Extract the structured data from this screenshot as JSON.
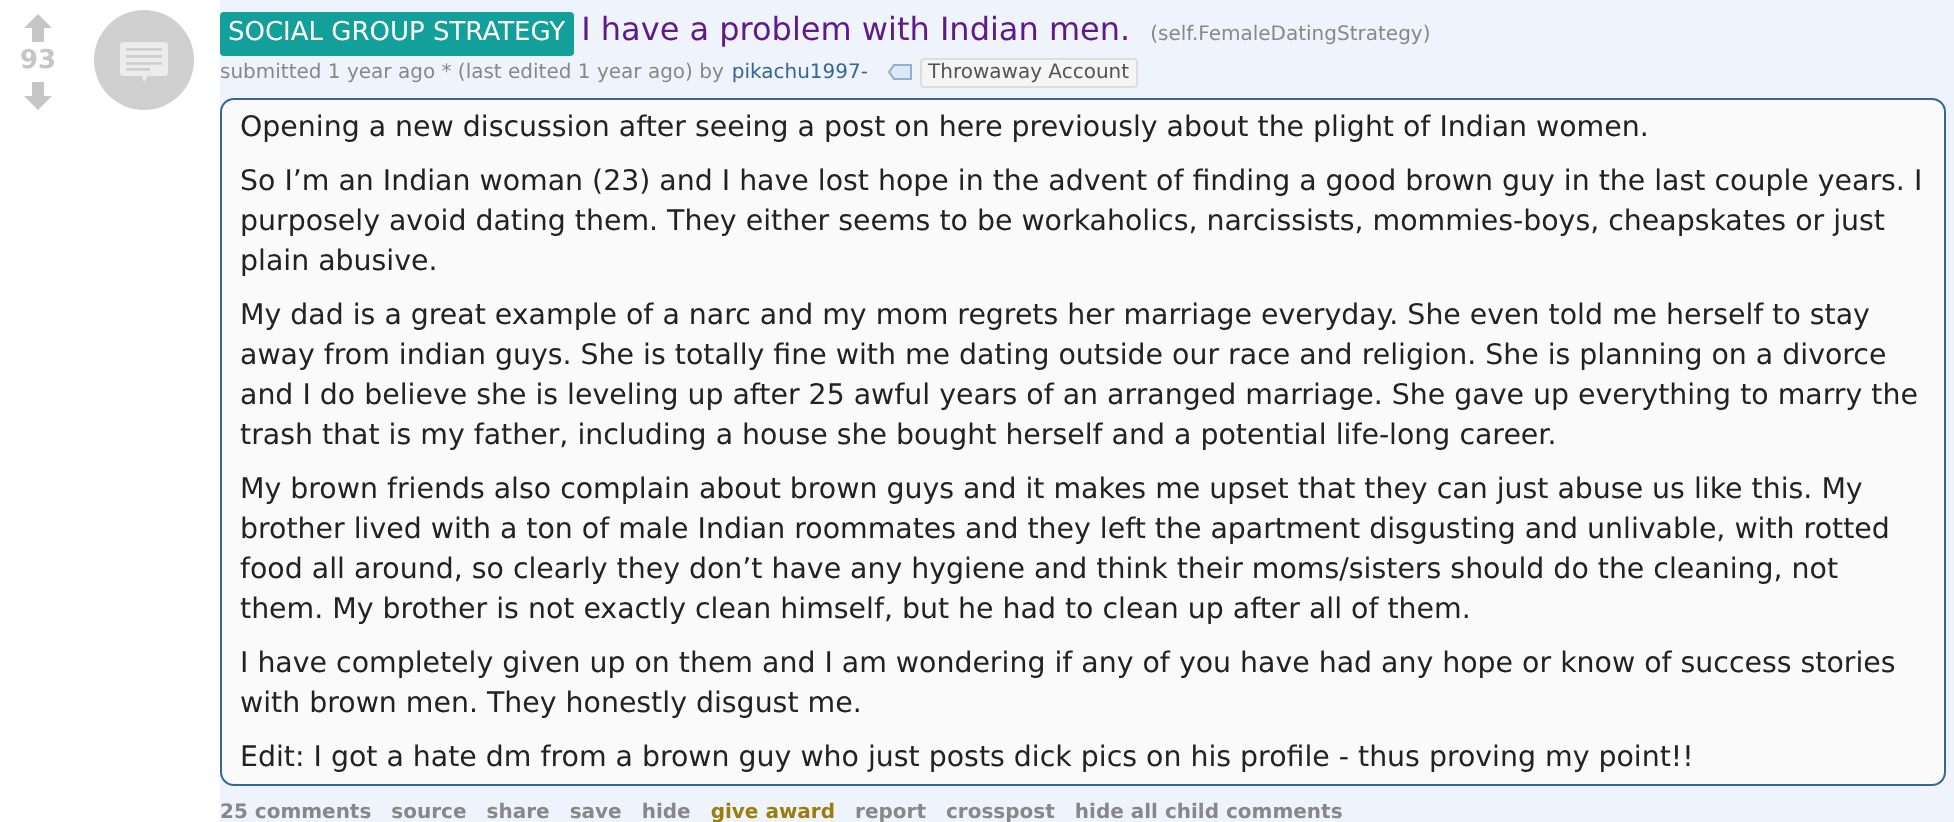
{
  "vote": {
    "score": "93"
  },
  "post": {
    "flair": "SOCIAL GROUP STRATEGY",
    "title": "I have a problem with Indian men.",
    "domain": "(self.FemaleDatingStrategy)",
    "tagline": {
      "prefix": "submitted 1 year ago * (last edited 1 year ago) by",
      "author": "pikachu1997-",
      "user_flair": "Throwaway Account"
    },
    "paragraphs": [
      "Opening a new discussion after seeing a post on here previously about the plight of Indian women.",
      "So I’m an Indian woman (23) and I have lost hope in the advent of finding a good brown guy in the last couple years. I purposely avoid dating them. They either seems to be workaholics, narcissists, mommies-boys, cheapskates or just plain abusive.",
      "My dad is a great example of a narc and my mom regrets her marriage everyday. She even told me herself to stay away from indian guys. She is totally fine with me dating outside our race and religion. She is planning on a divorce and I do believe she is leveling up after 25 awful years of an arranged marriage. She gave up everything to marry the trash that is my father, including a house she bought herself and a potential life-long career.",
      "My brown friends also complain about brown guys and it makes me upset that they can just abuse us like this. My brother lived with a ton of male Indian roommates and they left the apartment disgusting and unlivable, with rotted food all around, so clearly they don’t have any hygiene and think their moms/sisters should do the cleaning, not them. My brother is not exactly clean himself, but he had to clean up after all of them.",
      "I have completely given up on them and I am wondering if any of you have had any hope or know of success stories with brown men. They honestly disgust me.",
      "Edit: I got a hate dm from a brown guy who just posts dick pics on his profile - thus proving my point!!"
    ],
    "actions": [
      {
        "label": "25 comments",
        "kind": "normal"
      },
      {
        "label": "source",
        "kind": "normal"
      },
      {
        "label": "share",
        "kind": "normal"
      },
      {
        "label": "save",
        "kind": "normal"
      },
      {
        "label": "hide",
        "kind": "normal"
      },
      {
        "label": "give award",
        "kind": "gold"
      },
      {
        "label": "report",
        "kind": "normal"
      },
      {
        "label": "crosspost",
        "kind": "normal"
      },
      {
        "label": "hide all child comments",
        "kind": "normal"
      }
    ]
  }
}
